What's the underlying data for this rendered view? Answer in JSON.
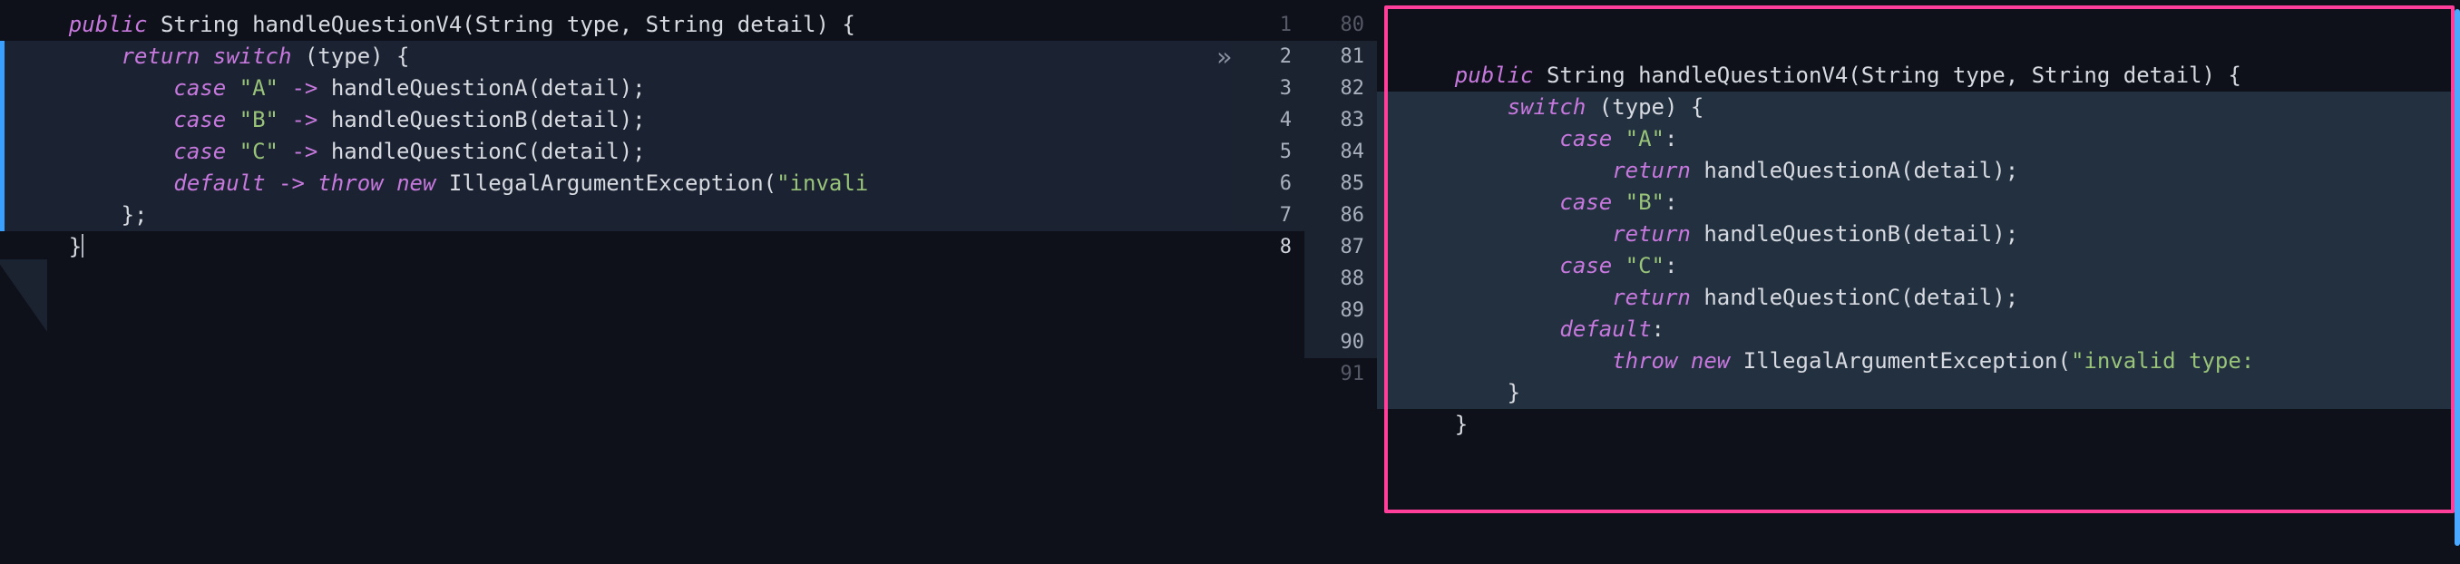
{
  "left": {
    "lines": [
      {
        "num": "",
        "changed": false,
        "sigil": "",
        "tokens": [
          {
            "c": "pn",
            "t": "    "
          },
          {
            "c": "kw",
            "t": "public"
          },
          {
            "c": "pn",
            "t": " "
          },
          {
            "c": "ty",
            "t": "String"
          },
          {
            "c": "pn",
            "t": " "
          },
          {
            "c": "fn",
            "t": "handleQuestionV4"
          },
          {
            "c": "pn",
            "t": "("
          },
          {
            "c": "ty",
            "t": "String"
          },
          {
            "c": "pn",
            "t": " "
          },
          {
            "c": "id",
            "t": "type"
          },
          {
            "c": "pn",
            "t": ", "
          },
          {
            "c": "ty",
            "t": "String"
          },
          {
            "c": "pn",
            "t": " "
          },
          {
            "c": "id",
            "t": "detail"
          },
          {
            "c": "pn",
            "t": ") {"
          }
        ]
      },
      {
        "num": "",
        "changed": true,
        "sigil": "»",
        "tokens": [
          {
            "c": "pn",
            "t": "        "
          },
          {
            "c": "kw",
            "t": "return"
          },
          {
            "c": "pn",
            "t": " "
          },
          {
            "c": "kw",
            "t": "switch"
          },
          {
            "c": "pn",
            "t": " ("
          },
          {
            "c": "id",
            "t": "type"
          },
          {
            "c": "pn",
            "t": ") {"
          }
        ]
      },
      {
        "num": "",
        "changed": true,
        "sigil": "",
        "tokens": [
          {
            "c": "pn",
            "t": "            "
          },
          {
            "c": "kw",
            "t": "case"
          },
          {
            "c": "pn",
            "t": " "
          },
          {
            "c": "st",
            "t": "\"A\""
          },
          {
            "c": "pn",
            "t": " "
          },
          {
            "c": "ar",
            "t": "->"
          },
          {
            "c": "pn",
            "t": " "
          },
          {
            "c": "fn",
            "t": "handleQuestionA"
          },
          {
            "c": "pn",
            "t": "("
          },
          {
            "c": "id",
            "t": "detail"
          },
          {
            "c": "pn",
            "t": ");"
          }
        ]
      },
      {
        "num": "",
        "changed": true,
        "sigil": "",
        "tokens": [
          {
            "c": "pn",
            "t": "            "
          },
          {
            "c": "kw",
            "t": "case"
          },
          {
            "c": "pn",
            "t": " "
          },
          {
            "c": "st",
            "t": "\"B\""
          },
          {
            "c": "pn",
            "t": " "
          },
          {
            "c": "ar",
            "t": "->"
          },
          {
            "c": "pn",
            "t": " "
          },
          {
            "c": "fn",
            "t": "handleQuestionB"
          },
          {
            "c": "pn",
            "t": "("
          },
          {
            "c": "id",
            "t": "detail"
          },
          {
            "c": "pn",
            "t": ");"
          }
        ]
      },
      {
        "num": "",
        "changed": true,
        "sigil": "",
        "tokens": [
          {
            "c": "pn",
            "t": "            "
          },
          {
            "c": "kw",
            "t": "case"
          },
          {
            "c": "pn",
            "t": " "
          },
          {
            "c": "st",
            "t": "\"C\""
          },
          {
            "c": "pn",
            "t": " "
          },
          {
            "c": "ar",
            "t": "->"
          },
          {
            "c": "pn",
            "t": " "
          },
          {
            "c": "fn",
            "t": "handleQuestionC"
          },
          {
            "c": "pn",
            "t": "("
          },
          {
            "c": "id",
            "t": "detail"
          },
          {
            "c": "pn",
            "t": ");"
          }
        ]
      },
      {
        "num": "",
        "changed": true,
        "sigil": "",
        "tokens": [
          {
            "c": "pn",
            "t": "            "
          },
          {
            "c": "kw",
            "t": "default"
          },
          {
            "c": "pn",
            "t": " "
          },
          {
            "c": "ar",
            "t": "->"
          },
          {
            "c": "pn",
            "t": " "
          },
          {
            "c": "kw",
            "t": "throw"
          },
          {
            "c": "pn",
            "t": " "
          },
          {
            "c": "kw",
            "t": "new"
          },
          {
            "c": "pn",
            "t": " "
          },
          {
            "c": "cls",
            "t": "IllegalArgumentException"
          },
          {
            "c": "pn",
            "t": "("
          },
          {
            "c": "st",
            "t": "\"invali"
          }
        ]
      },
      {
        "num": "",
        "changed": true,
        "sigil": "",
        "tokens": [
          {
            "c": "pn",
            "t": "        };"
          }
        ]
      },
      {
        "num": "",
        "changed": false,
        "sigil": "",
        "cursor": true,
        "tokens": [
          {
            "c": "pn",
            "t": "    }"
          }
        ]
      }
    ],
    "gutter": [
      "1",
      "2",
      "3",
      "4",
      "5",
      "6",
      "7",
      "8"
    ]
  },
  "right": {
    "lines": [
      {
        "num": "80",
        "changed": false,
        "tokens": [
          {
            "c": "pn",
            "t": "    "
          },
          {
            "c": "kw",
            "t": "public"
          },
          {
            "c": "pn",
            "t": " "
          },
          {
            "c": "ty",
            "t": "String"
          },
          {
            "c": "pn",
            "t": " "
          },
          {
            "c": "fn",
            "t": "handleQuestionV4"
          },
          {
            "c": "pn",
            "t": "("
          },
          {
            "c": "ty",
            "t": "String"
          },
          {
            "c": "pn",
            "t": " "
          },
          {
            "c": "id",
            "t": "type"
          },
          {
            "c": "pn",
            "t": ", "
          },
          {
            "c": "ty",
            "t": "String"
          },
          {
            "c": "pn",
            "t": " "
          },
          {
            "c": "id",
            "t": "detail"
          },
          {
            "c": "pn",
            "t": ") {"
          }
        ]
      },
      {
        "num": "81",
        "changed": true,
        "tokens": [
          {
            "c": "pn",
            "t": "        "
          },
          {
            "c": "kw",
            "t": "switch"
          },
          {
            "c": "pn",
            "t": " ("
          },
          {
            "c": "id",
            "t": "type"
          },
          {
            "c": "pn",
            "t": ") {"
          }
        ]
      },
      {
        "num": "82",
        "changed": true,
        "tokens": [
          {
            "c": "pn",
            "t": "            "
          },
          {
            "c": "kw",
            "t": "case"
          },
          {
            "c": "pn",
            "t": " "
          },
          {
            "c": "st",
            "t": "\"A\""
          },
          {
            "c": "pn",
            "t": ":"
          }
        ]
      },
      {
        "num": "83",
        "changed": true,
        "tokens": [
          {
            "c": "pn",
            "t": "                "
          },
          {
            "c": "kw",
            "t": "return"
          },
          {
            "c": "pn",
            "t": " "
          },
          {
            "c": "fn",
            "t": "handleQuestionA"
          },
          {
            "c": "pn",
            "t": "("
          },
          {
            "c": "id",
            "t": "detail"
          },
          {
            "c": "pn",
            "t": ");"
          }
        ]
      },
      {
        "num": "84",
        "changed": true,
        "tokens": [
          {
            "c": "pn",
            "t": "            "
          },
          {
            "c": "kw",
            "t": "case"
          },
          {
            "c": "pn",
            "t": " "
          },
          {
            "c": "st",
            "t": "\"B\""
          },
          {
            "c": "pn",
            "t": ":"
          }
        ]
      },
      {
        "num": "85",
        "changed": true,
        "tokens": [
          {
            "c": "pn",
            "t": "                "
          },
          {
            "c": "kw",
            "t": "return"
          },
          {
            "c": "pn",
            "t": " "
          },
          {
            "c": "fn",
            "t": "handleQuestionB"
          },
          {
            "c": "pn",
            "t": "("
          },
          {
            "c": "id",
            "t": "detail"
          },
          {
            "c": "pn",
            "t": ");"
          }
        ]
      },
      {
        "num": "86",
        "changed": true,
        "tokens": [
          {
            "c": "pn",
            "t": "            "
          },
          {
            "c": "kw",
            "t": "case"
          },
          {
            "c": "pn",
            "t": " "
          },
          {
            "c": "st",
            "t": "\"C\""
          },
          {
            "c": "pn",
            "t": ":"
          }
        ]
      },
      {
        "num": "87",
        "changed": true,
        "tokens": [
          {
            "c": "pn",
            "t": "                "
          },
          {
            "c": "kw",
            "t": "return"
          },
          {
            "c": "pn",
            "t": " "
          },
          {
            "c": "fn",
            "t": "handleQuestionC"
          },
          {
            "c": "pn",
            "t": "("
          },
          {
            "c": "id",
            "t": "detail"
          },
          {
            "c": "pn",
            "t": ");"
          }
        ]
      },
      {
        "num": "88",
        "changed": true,
        "tokens": [
          {
            "c": "pn",
            "t": "            "
          },
          {
            "c": "kw",
            "t": "default"
          },
          {
            "c": "pn",
            "t": ":"
          }
        ]
      },
      {
        "num": "89",
        "changed": true,
        "tokens": [
          {
            "c": "pn",
            "t": "                "
          },
          {
            "c": "kw",
            "t": "throw"
          },
          {
            "c": "pn",
            "t": " "
          },
          {
            "c": "kw",
            "t": "new"
          },
          {
            "c": "pn",
            "t": " "
          },
          {
            "c": "cls",
            "t": "IllegalArgumentException"
          },
          {
            "c": "pn",
            "t": "("
          },
          {
            "c": "st",
            "t": "\"invalid type:"
          }
        ]
      },
      {
        "num": "90",
        "changed": true,
        "tokens": [
          {
            "c": "pn",
            "t": "        }"
          }
        ]
      },
      {
        "num": "91",
        "changed": false,
        "tokens": [
          {
            "c": "pn",
            "t": "    }"
          }
        ]
      }
    ]
  }
}
